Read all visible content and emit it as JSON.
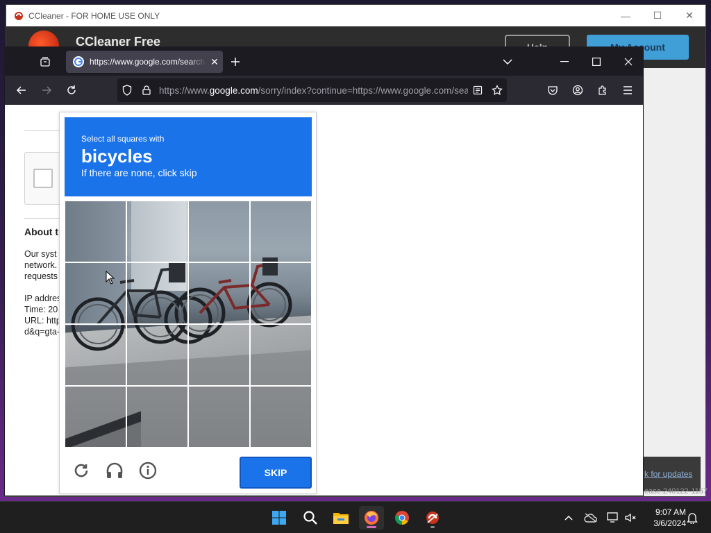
{
  "ccleaner": {
    "window_title": "CCleaner - FOR HOME USE ONLY",
    "brand_name": "CCleaner Free",
    "help_label": "Help",
    "account_label": "My Account",
    "updates_link": "k for updates",
    "version_text": "ease.240122-1157"
  },
  "firefox": {
    "tab_title": "https://www.google.com/search",
    "url_prefix": "https://www.",
    "url_host": "google.com",
    "url_rest": "/sorry/index?continue=https://www.google.com/search"
  },
  "sorry_page": {
    "heading": "About th",
    "lines": [
      "Our syst",
      "network.",
      "requests",
      "IP addres",
      "Time: 20",
      "URL: http",
      "d&q=gta-"
    ]
  },
  "captcha": {
    "instruction": "Select all squares with",
    "keyword": "bicycles",
    "hint": "If there are none, click skip",
    "skip_label": "SKIP",
    "grid_rows": 4,
    "grid_cols": 4
  },
  "taskbar": {
    "time": "9:07 AM",
    "date": "3/6/2024"
  },
  "colors": {
    "captcha_blue": "#1a73e8",
    "firefox_dark": "#1c1b22",
    "ccleaner_accent": "#3f9fd6"
  },
  "icons": [
    "reload-icon",
    "audio-icon",
    "info-icon",
    "windows-start-icon",
    "search-icon",
    "file-explorer-icon",
    "firefox-icon",
    "chrome-icon",
    "ccleaner-icon"
  ]
}
